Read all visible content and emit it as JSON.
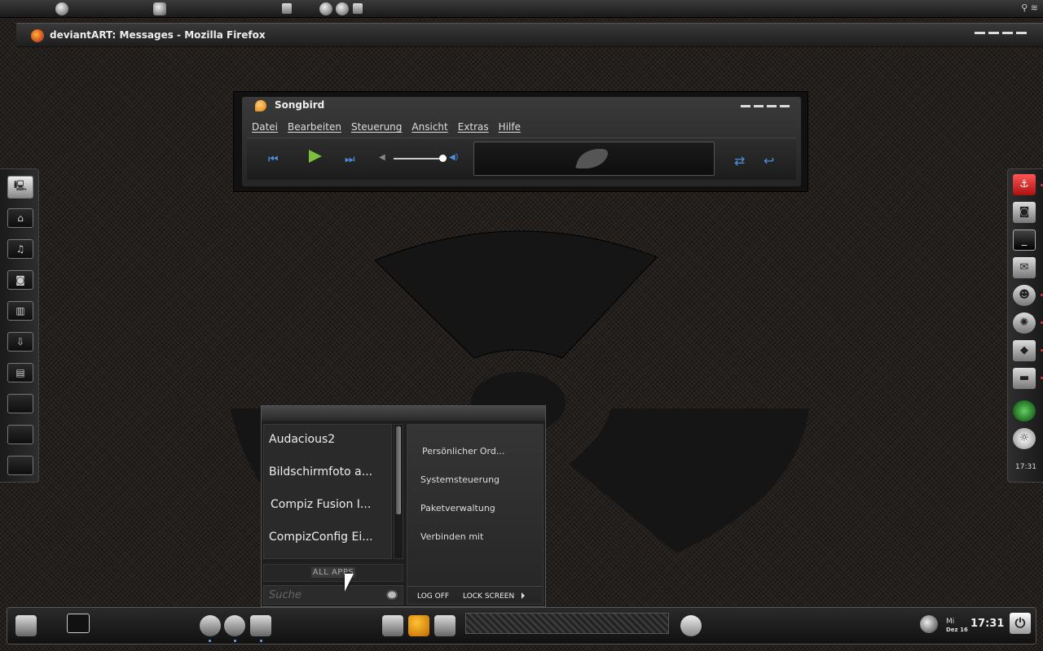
{
  "firefox": {
    "title": "deviantART: Messages - Mozilla Firefox"
  },
  "songbird": {
    "title": "Songbird",
    "menu": [
      "Datei",
      "Bearbeiten",
      "Steuerung",
      "Ansicht",
      "Extras",
      "Hilfe"
    ],
    "volume_level": 0.85
  },
  "start_menu": {
    "apps": [
      "Audacious2",
      "Bildschirmfoto a...",
      "Compiz Fusion I...",
      "CompizConfig Ei..."
    ],
    "all_apps_label": "ALL APPS",
    "search_placeholder": "Suche",
    "places": [
      "Persönlicher Ord...",
      "Systemsteuerung",
      "Paketverwaltung",
      "Verbinden mit"
    ],
    "log_off": "LOG OFF",
    "lock_screen": "LOCK SCREEN"
  },
  "right_dock": {
    "clock": "17:31"
  },
  "taskbar": {
    "day": "Mi",
    "date": "Dez 16",
    "time": "17:31"
  },
  "colors": {
    "play": "#7cbf3a",
    "transport": "#4a8fd8",
    "anchor": "#d33333"
  }
}
